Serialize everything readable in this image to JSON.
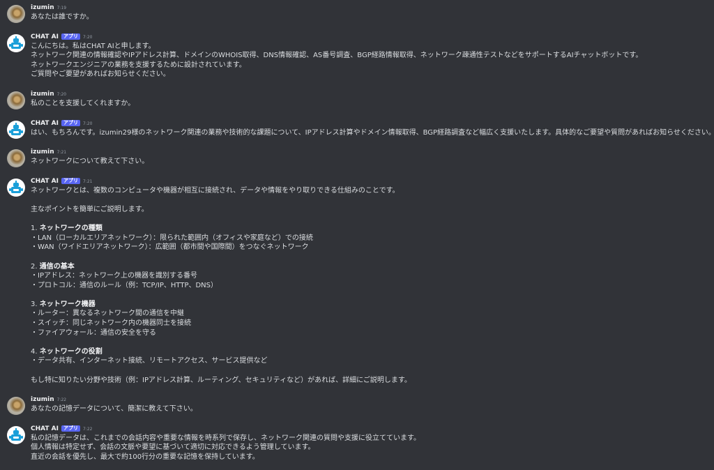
{
  "messages": [
    {
      "author": "izumin",
      "time": "7:19",
      "lines": [
        "あなたは誰ですか。"
      ]
    },
    {
      "author": "CHAT AI",
      "badge": "アプリ",
      "time": "7:20",
      "lines": [
        "こんにちは。私はCHAT AIと申します。",
        "ネットワーク関連の情報確認やIPアドレス計算、ドメインのWHOIS取得、DNS情報確認、AS番号調査、BGP経路情報取得、ネットワーク疎通性テストなどをサポートするAIチャットボットです。",
        "ネットワークエンジニアの業務を支援するために設計されています。",
        "ご質問やご要望があればお知らせください。"
      ]
    },
    {
      "author": "izumin",
      "time": "7:20",
      "lines": [
        "私のことを支援してくれますか。"
      ]
    },
    {
      "author": "CHAT AI",
      "badge": "アプリ",
      "time": "7:20",
      "lines": [
        "はい、もちろんです。izumin29様のネットワーク関連の業務や技術的な課題について、IPアドレス計算やドメイン情報取得、BGP経路調査など幅広く支援いたします。具体的なご要望や質問があればお知らせください。"
      ]
    },
    {
      "author": "izumin",
      "time": "7:21",
      "lines": [
        "ネットワークについて教えて下さい。"
      ]
    },
    {
      "author": "CHAT AI",
      "badge": "アプリ",
      "time": "7:21",
      "lines": [
        "ネットワークとは、複数のコンピュータや機器が相互に接続され、データや情報をやり取りできる仕組みのことです。",
        "",
        "主なポイントを簡単にご説明します。",
        "",
        "1. **ネットワークの種類**",
        "・LAN（ローカルエリアネットワーク）：限られた範囲内（オフィスや家庭など）での接続",
        "・WAN（ワイドエリアネットワーク）：広範囲（都市間や国際間）をつなぐネットワーク",
        "",
        "2. **通信の基本**",
        "・IPアドレス：ネットワーク上の機器を識別する番号",
        "・プロトコル：通信のルール（例：TCP/IP、HTTP、DNS）",
        "",
        "3. **ネットワーク機器**",
        "・ルーター：異なるネットワーク間の通信を中継",
        "・スイッチ：同じネットワーク内の機器同士を接続",
        "・ファイアウォール：通信の安全を守る",
        "",
        "4. **ネットワークの役割**",
        "・データ共有、インターネット接続、リモートアクセス、サービス提供など",
        "",
        "もし特に知りたい分野や技術（例：IPアドレス計算、ルーティング、セキュリティなど）があれば、詳細にご説明します。"
      ]
    },
    {
      "author": "izumin",
      "time": "7:22",
      "lines": [
        "あなたの記憶データについて、簡潔に教えて下さい。"
      ]
    },
    {
      "author": "CHAT AI",
      "badge": "アプリ",
      "time": "7:22",
      "lines": [
        "私の記憶データは、これまでの会話内容や重要な情報を時系列で保存し、ネットワーク関連の質問や支援に役立てています。",
        "個人情報は特定せず、会話の文脈や要望に基づいて適切に対応できるよう管理しています。",
        "直近の会話を優先し、最大で約100行分の重要な記憶を保持しています。"
      ]
    }
  ]
}
